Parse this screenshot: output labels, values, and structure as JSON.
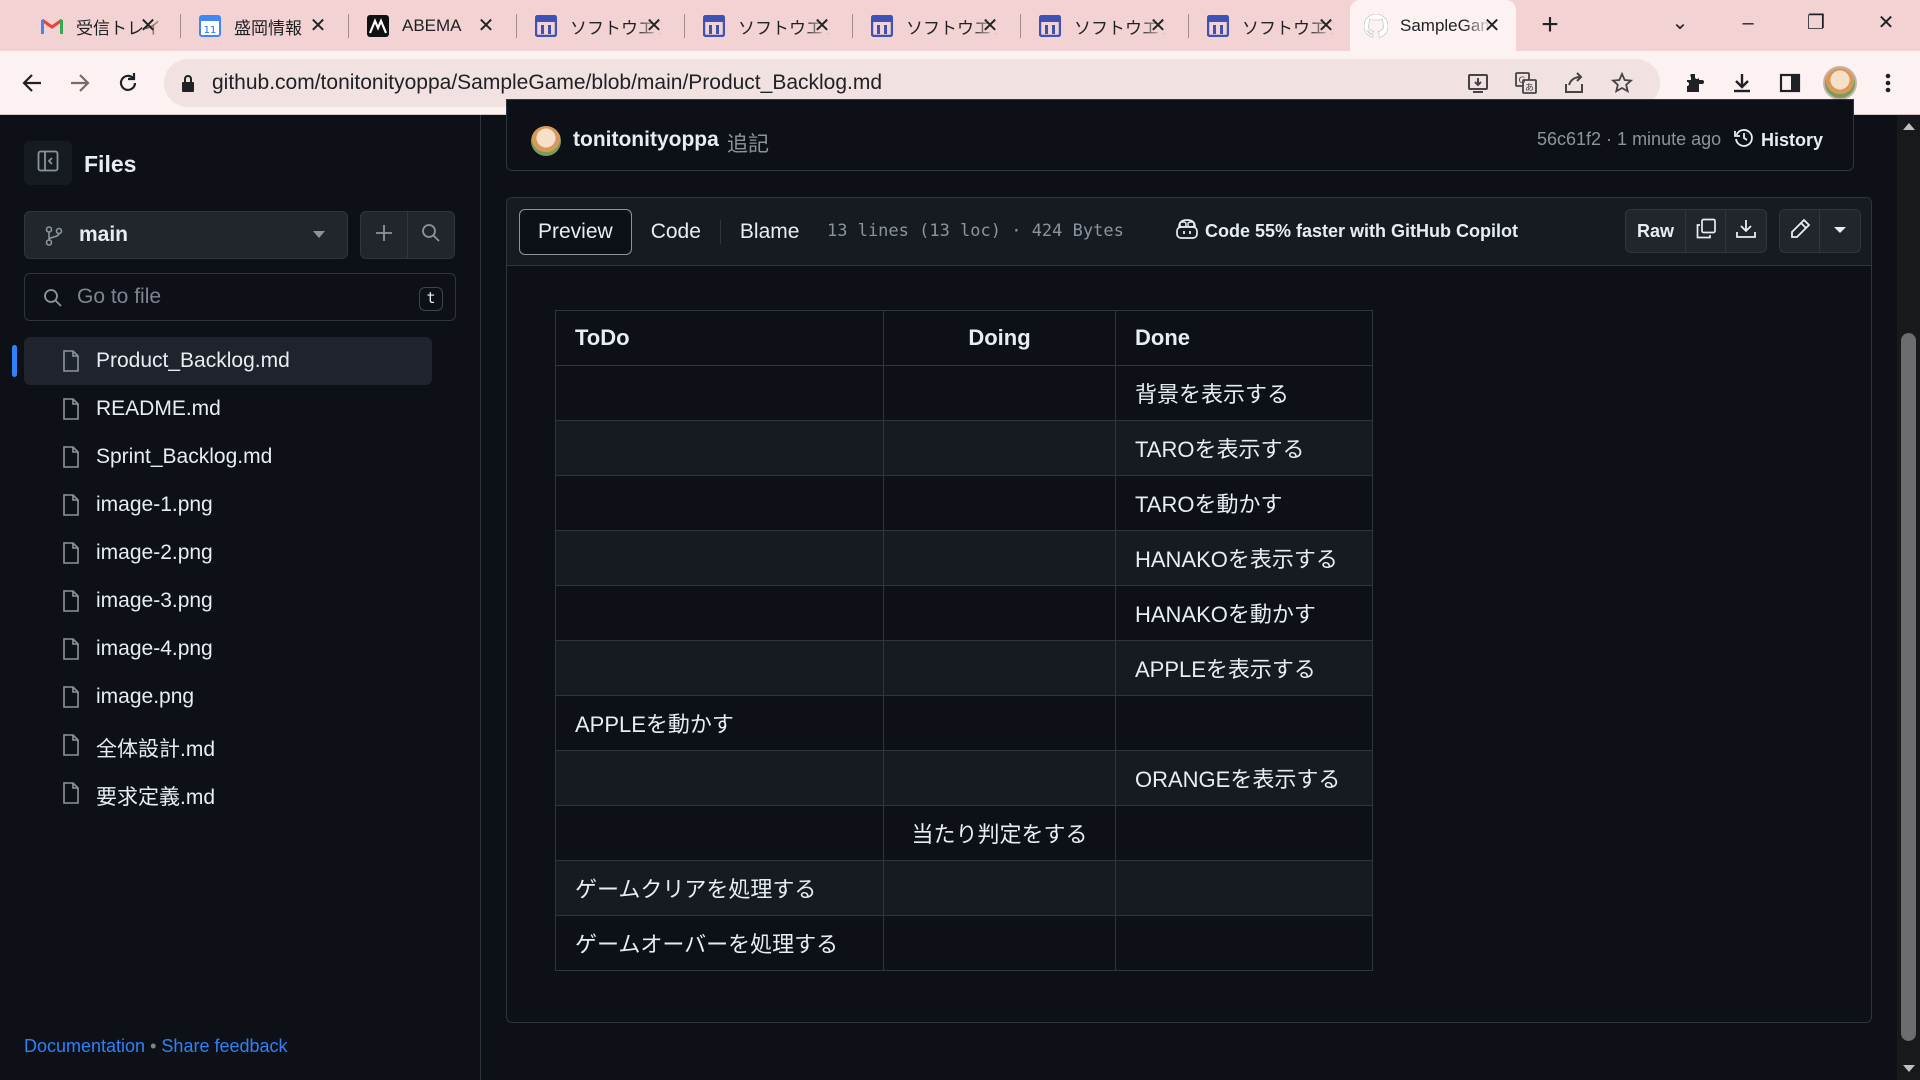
{
  "browser": {
    "tabs": [
      {
        "title": "受信トレイ",
        "icon": "gmail-icon"
      },
      {
        "title": "盛岡情報",
        "icon": "calendar-icon"
      },
      {
        "title": "ABEMA",
        "icon": "abema-icon"
      },
      {
        "title": "ソフトウエア",
        "icon": "forms-icon"
      },
      {
        "title": "ソフトウエア",
        "icon": "forms-icon"
      },
      {
        "title": "ソフトウエア",
        "icon": "forms-icon"
      },
      {
        "title": "ソフトウエア",
        "icon": "forms-icon"
      },
      {
        "title": "ソフトウエア",
        "icon": "forms-icon"
      },
      {
        "title": "SampleGame",
        "icon": "github-icon",
        "active": true
      }
    ],
    "new_tab": "+",
    "url": "github.com/tonitonityoppa/SampleGame/blob/main/Product_Backlog.md"
  },
  "sidebar": {
    "title": "Files",
    "branch": "main",
    "goto_placeholder": "Go to file",
    "goto_shortcut": "t",
    "files": [
      {
        "name": "Product_Backlog.md",
        "selected": true
      },
      {
        "name": "README.md"
      },
      {
        "name": "Sprint_Backlog.md"
      },
      {
        "name": "image-1.png"
      },
      {
        "name": "image-2.png"
      },
      {
        "name": "image-3.png"
      },
      {
        "name": "image-4.png"
      },
      {
        "name": "image.png"
      },
      {
        "name": "全体設計.md"
      },
      {
        "name": "要求定義.md"
      }
    ],
    "footer": {
      "documentation": "Documentation",
      "separator": "•",
      "feedback": "Share feedback"
    }
  },
  "commit": {
    "user": "tonitonityoppa",
    "message": "追記",
    "meta": "56c61f2 · 1 minute ago",
    "history_label": "History"
  },
  "file_header": {
    "tabs": [
      "Preview",
      "Code",
      "Blame"
    ],
    "active_tab": "Preview",
    "info": "13 lines (13 loc) · 424 Bytes",
    "copilot": "Code 55% faster with GitHub Copilot",
    "raw_label": "Raw"
  },
  "board": {
    "headers": [
      "ToDo",
      "Doing",
      "Done"
    ],
    "rows": [
      [
        "",
        "",
        "背景を表示する"
      ],
      [
        "",
        "",
        "TAROを表示する"
      ],
      [
        "",
        "",
        "TAROを動かす"
      ],
      [
        "",
        "",
        "HANAKOを表示する"
      ],
      [
        "",
        "",
        "HANAKOを動かす"
      ],
      [
        "",
        "",
        "APPLEを表示する"
      ],
      [
        "APPLEを動かす",
        "",
        ""
      ],
      [
        "",
        "",
        "ORANGEを表示する"
      ],
      [
        "",
        "当たり判定をする",
        ""
      ],
      [
        "ゲームクリアを処理する",
        "",
        ""
      ],
      [
        "ゲームオーバーを処理する",
        "",
        ""
      ]
    ]
  },
  "colors": {
    "accent": "#2f81f7",
    "bg": "#0d1117",
    "border": "#30363d",
    "tabstrip": "#f2d2d2"
  }
}
